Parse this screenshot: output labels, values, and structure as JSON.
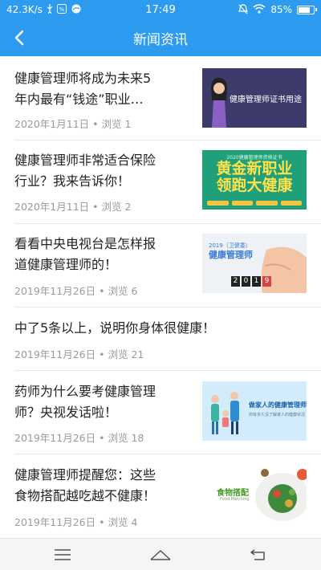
{
  "status_bar": {
    "speed": "42.3K/s",
    "time": "17:49",
    "battery_text": "85%",
    "battery_level": 0.85
  },
  "header": {
    "title": "新闻资讯",
    "back_icon": "chevron-left-icon"
  },
  "articles": [
    {
      "title_line1": "健康管理师将成为未来5",
      "title_line2": "年内最有“钱途”职业…",
      "date": "2020年1月11日",
      "views": "浏览 1",
      "thumb_text": "健康管理师证书用途"
    },
    {
      "title_line1": "健康管理师非常适合保险",
      "title_line2": "行业？我来告诉你！",
      "date": "2020年1月11日",
      "views": "浏览 2",
      "thumb_top": "2020健康管理师资格证书",
      "thumb_line1": "黄金新职业",
      "thumb_line2": "领跑大健康"
    },
    {
      "title_line1": "看看中央电视台是怎样报",
      "title_line2": "道健康管理师的！",
      "date": "2019年11月26日",
      "views": "浏览 6",
      "thumb_line1": "2019（卫健委）",
      "thumb_line2": "健康管理师",
      "thumb_digits": [
        "2",
        "0",
        "1",
        "9"
      ]
    },
    {
      "title_line1": "中了5条以上，说明你身体很健康！",
      "date": "2019年11月26日",
      "views": "浏览 21"
    },
    {
      "title_line1": "药师为什么要考健康管理",
      "title_line2": "师？央视发话啦！",
      "date": "2019年11月26日",
      "views": "浏览 18",
      "thumb_line1": "做家人的健康管理师",
      "thumb_line2": "你有多久没了解家人的健康状况"
    },
    {
      "title_line1": "健康管理师提醒您：这些",
      "title_line2": "食物搭配越吃越不健康！",
      "date": "2019年11月26日",
      "views": "浏览 4",
      "thumb_line1": "食物搭配",
      "thumb_line2": "Food Matching"
    }
  ],
  "separator": "•",
  "bottom_nav": {
    "menu_icon": "menu-icon",
    "home_icon": "home-icon",
    "back_icon": "back-arrow-icon"
  },
  "colors": {
    "brand": "#2d9cf0",
    "title_text": "#222222",
    "meta_text": "#9a9a9a"
  }
}
